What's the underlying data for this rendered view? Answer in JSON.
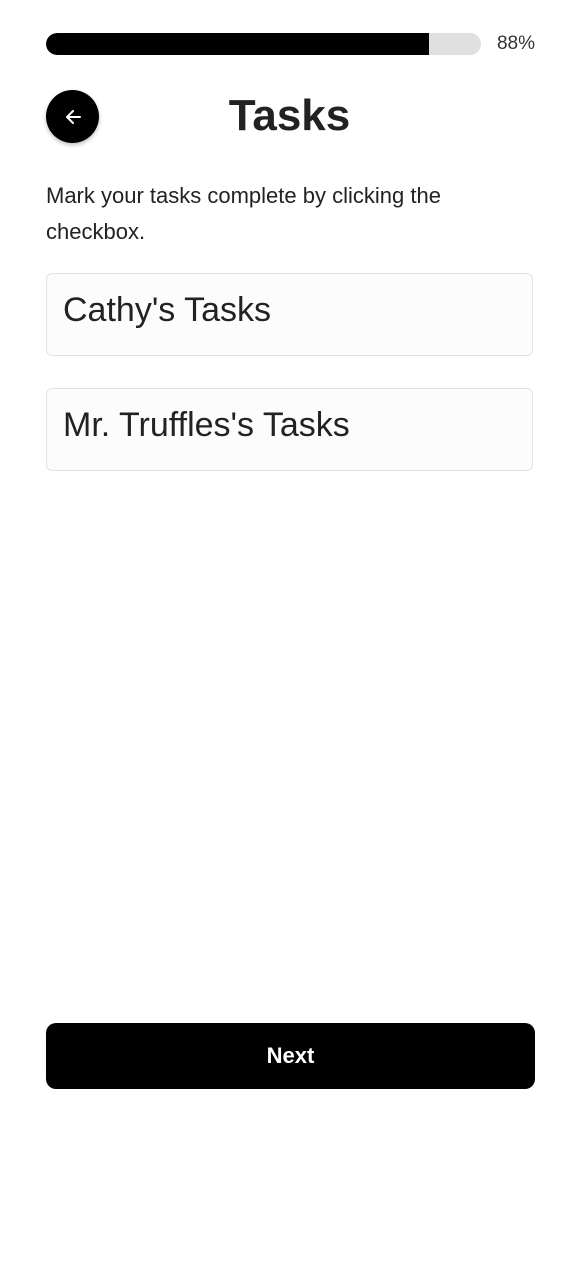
{
  "progress": {
    "value": 0.88,
    "label": "88%"
  },
  "header": {
    "back_icon": "arrow-left-icon",
    "title": "Tasks"
  },
  "instructions": "Mark your tasks complete by clicking the checkbox.",
  "task_groups": [
    {
      "label": "Cathy's Tasks"
    },
    {
      "label": "Mr. Truffles's Tasks"
    }
  ],
  "footer": {
    "next_label": "Next"
  },
  "colors": {
    "accent": "#000000",
    "progress_track": "#e0e0e0",
    "text": "#222222",
    "card_background": "#fcfcfc",
    "card_border": "#e2e2e2"
  }
}
